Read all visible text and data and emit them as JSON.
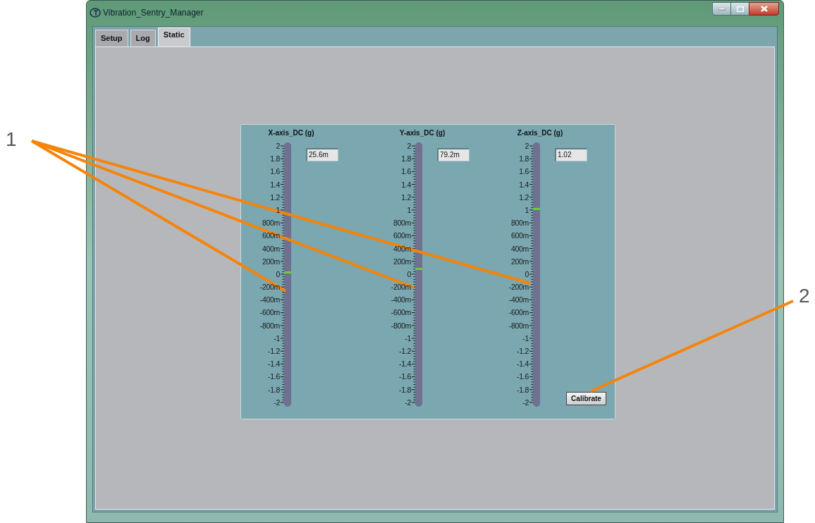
{
  "window": {
    "title": "Vibration_Sentry_Manager"
  },
  "tabs": [
    {
      "label": "Setup",
      "selected": false
    },
    {
      "label": "Log",
      "selected": false
    },
    {
      "label": "Static",
      "selected": true
    }
  ],
  "gauges": [
    {
      "label": "X-axis_DC (g)",
      "value": "25.6m",
      "level": 0.506,
      "scale_labels": [
        "2",
        "1.8",
        "1.6",
        "1.4",
        "1.2",
        "1",
        "800m",
        "600m",
        "400m",
        "200m",
        "0",
        "-200m",
        "-400m",
        "-600m",
        "-800m",
        "-1",
        "-1.2",
        "-1.4",
        "-1.6",
        "-1.8",
        "-2"
      ]
    },
    {
      "label": "Y-axis_DC (g)",
      "value": "79.2m",
      "level": 0.52,
      "scale_labels": [
        "2",
        "1.8",
        "1.6",
        "1.4",
        "1.2",
        "1",
        "800m",
        "600m",
        "400m",
        "200m",
        "0",
        "-200m",
        "-400m",
        "-600m",
        "-800m",
        "-1",
        "-1.2",
        "-1.4",
        "-1.6",
        "-1.8",
        "-2"
      ]
    },
    {
      "label": "Z-axis_DC (g)",
      "value": "1.02",
      "level": 0.755,
      "scale_labels": [
        "2",
        "1.8",
        "1.6",
        "1.4",
        "1.2",
        "1",
        "800m",
        "600m",
        "400m",
        "200m",
        "0",
        "-200m",
        "-400m",
        "-600m",
        "-800m",
        "-1",
        "-1.2",
        "-1.4",
        "-1.6",
        "-1.8",
        "-2"
      ]
    }
  ],
  "calibrate_button": "Calibrate",
  "callouts": [
    {
      "number": "1"
    },
    {
      "number": "2"
    }
  ]
}
